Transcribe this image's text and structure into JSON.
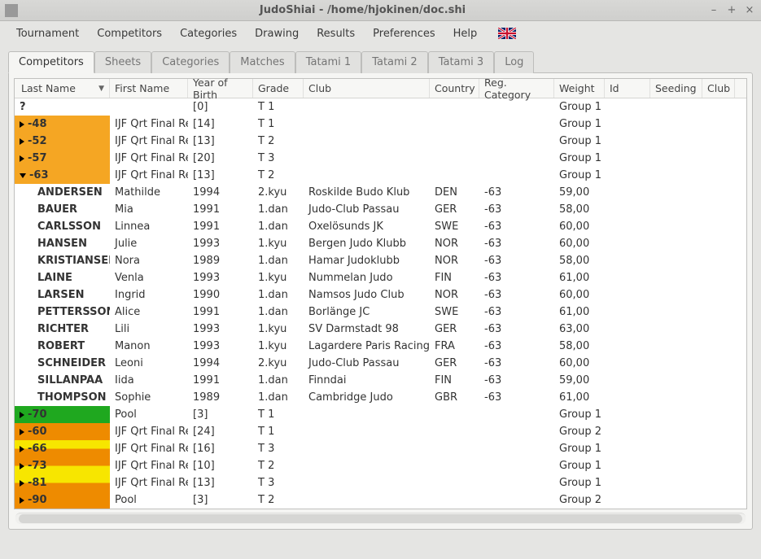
{
  "window": {
    "title": "JudoShiai - /home/hjokinen/doc.shi"
  },
  "menu": {
    "items": [
      "Tournament",
      "Competitors",
      "Categories",
      "Drawing",
      "Results",
      "Preferences",
      "Help"
    ]
  },
  "tabs": {
    "items": [
      "Competitors",
      "Sheets",
      "Categories",
      "Matches",
      "Tatami 1",
      "Tatami 2",
      "Tatami 3",
      "Log"
    ],
    "active": 0
  },
  "columns": {
    "last_name": "Last Name",
    "first_name": "First Name",
    "yob": "Year of Birth",
    "grade": "Grade",
    "club": "Club",
    "country": "Country",
    "reg_cat": "Reg. Category",
    "weight": "Weight",
    "id": "Id",
    "seeding": "Seeding",
    "club2": "Club"
  },
  "rows": [
    {
      "type": "cat",
      "style": "plain",
      "last": "?",
      "first": "",
      "yob": "[0]",
      "grade": "T 1",
      "weight": "Group 1"
    },
    {
      "type": "cat",
      "style": "orange",
      "last": "-48",
      "tri": "right",
      "first": "IJF Qrt Final Rep",
      "yob": "[14]",
      "grade": "T 1",
      "weight": "Group 1"
    },
    {
      "type": "cat",
      "style": "orange",
      "last": "-52",
      "tri": "right",
      "first": "IJF Qrt Final Rep",
      "yob": "[13]",
      "grade": "T 2",
      "weight": "Group 1"
    },
    {
      "type": "cat",
      "style": "orange",
      "last": "-57",
      "tri": "right",
      "first": "IJF Qrt Final Rep",
      "yob": "[20]",
      "grade": "T 3",
      "weight": "Group 1"
    },
    {
      "type": "cat",
      "style": "orange",
      "last": "-63",
      "tri": "down",
      "first": "IJF Qrt Final Rep",
      "yob": "[13]",
      "grade": "T 2",
      "weight": "Group 1"
    },
    {
      "type": "cmp",
      "last": "ANDERSEN",
      "first": "Mathilde",
      "yob": "1994",
      "grade": "2.kyu",
      "club": "Roskilde Budo Klub",
      "country": "DEN",
      "reg_cat": "-63",
      "weight": "59,00"
    },
    {
      "type": "cmp",
      "last": "BAUER",
      "first": "Mia",
      "yob": "1991",
      "grade": "1.dan",
      "club": "Judo-Club Passau",
      "country": "GER",
      "reg_cat": "-63",
      "weight": "58,00"
    },
    {
      "type": "cmp",
      "last": "CARLSSON",
      "first": "Linnea",
      "yob": "1991",
      "grade": "1.dan",
      "club": "Oxelösunds JK",
      "country": "SWE",
      "reg_cat": "-63",
      "weight": "60,00"
    },
    {
      "type": "cmp",
      "last": "HANSEN",
      "first": "Julie",
      "yob": "1993",
      "grade": "1.kyu",
      "club": "Bergen Judo Klubb",
      "country": "NOR",
      "reg_cat": "-63",
      "weight": "60,00"
    },
    {
      "type": "cmp",
      "last": "KRISTIANSEN",
      "first": "Nora",
      "yob": "1989",
      "grade": "1.dan",
      "club": "Hamar Judoklubb",
      "country": "NOR",
      "reg_cat": "-63",
      "weight": "58,00"
    },
    {
      "type": "cmp",
      "last": "LAINE",
      "first": "Venla",
      "yob": "1993",
      "grade": "1.kyu",
      "club": "Nummelan Judo",
      "country": "FIN",
      "reg_cat": "-63",
      "weight": "61,00"
    },
    {
      "type": "cmp",
      "last": "LARSEN",
      "first": "Ingrid",
      "yob": "1990",
      "grade": "1.dan",
      "club": "Namsos Judo Club",
      "country": "NOR",
      "reg_cat": "-63",
      "weight": "60,00"
    },
    {
      "type": "cmp",
      "last": "PETTERSSON",
      "first": "Alice",
      "yob": "1991",
      "grade": "1.dan",
      "club": "Borlänge JC",
      "country": "SWE",
      "reg_cat": "-63",
      "weight": "61,00"
    },
    {
      "type": "cmp",
      "last": "RICHTER",
      "first": "Lili",
      "yob": "1993",
      "grade": "1.kyu",
      "club": "SV Darmstadt 98",
      "country": "GER",
      "reg_cat": "-63",
      "weight": "63,00"
    },
    {
      "type": "cmp",
      "last": "ROBERT",
      "first": "Manon",
      "yob": "1993",
      "grade": "1.kyu",
      "club": "Lagardere Paris Racing",
      "country": "FRA",
      "reg_cat": "-63",
      "weight": "58,00"
    },
    {
      "type": "cmp",
      "last": "SCHNEIDER",
      "first": "Leoni",
      "yob": "1994",
      "grade": "2.kyu",
      "club": "Judo-Club Passau",
      "country": "GER",
      "reg_cat": "-63",
      "weight": "60,00"
    },
    {
      "type": "cmp",
      "last": "SILLANPÄÄ",
      "first": "Iida",
      "yob": "1991",
      "grade": "1.dan",
      "club": "Finndai",
      "country": "FIN",
      "reg_cat": "-63",
      "weight": "59,00"
    },
    {
      "type": "cmp",
      "last": "THOMPSON",
      "first": "Sophie",
      "yob": "1989",
      "grade": "1.dan",
      "club": "Cambridge Judo",
      "country": "GBR",
      "reg_cat": "-63",
      "weight": "61,00"
    },
    {
      "type": "cat",
      "style": "green",
      "last": "-70",
      "tri": "right",
      "first": "Pool",
      "yob": "[3]",
      "grade": "T 1",
      "weight": "Group 1"
    },
    {
      "type": "cat",
      "style": "darkorange",
      "last": "-60",
      "tri": "right",
      "first": "IJF Qrt Final Rep",
      "yob": "[24]",
      "grade": "T 1",
      "weight": "Group 2"
    },
    {
      "type": "cat",
      "style": "yellowtop",
      "last": "-66",
      "tri": "right",
      "first": "IJF Qrt Final Rep",
      "yob": "[16]",
      "grade": "T 3",
      "weight": "Group 1"
    },
    {
      "type": "cat",
      "style": "yellowbot",
      "last": "-73",
      "tri": "right",
      "first": "IJF Qrt Final Rep",
      "yob": "[10]",
      "grade": "T 2",
      "weight": "Group 1"
    },
    {
      "type": "cat",
      "style": "yellowtop",
      "last": "-81",
      "tri": "right",
      "first": "IJF Qrt Final Rep",
      "yob": "[13]",
      "grade": "T 3",
      "weight": "Group 1"
    },
    {
      "type": "cat",
      "style": "darkorange",
      "last": "-90",
      "tri": "right",
      "first": "Pool",
      "yob": "[3]",
      "grade": "T 2",
      "weight": "Group 2"
    }
  ]
}
